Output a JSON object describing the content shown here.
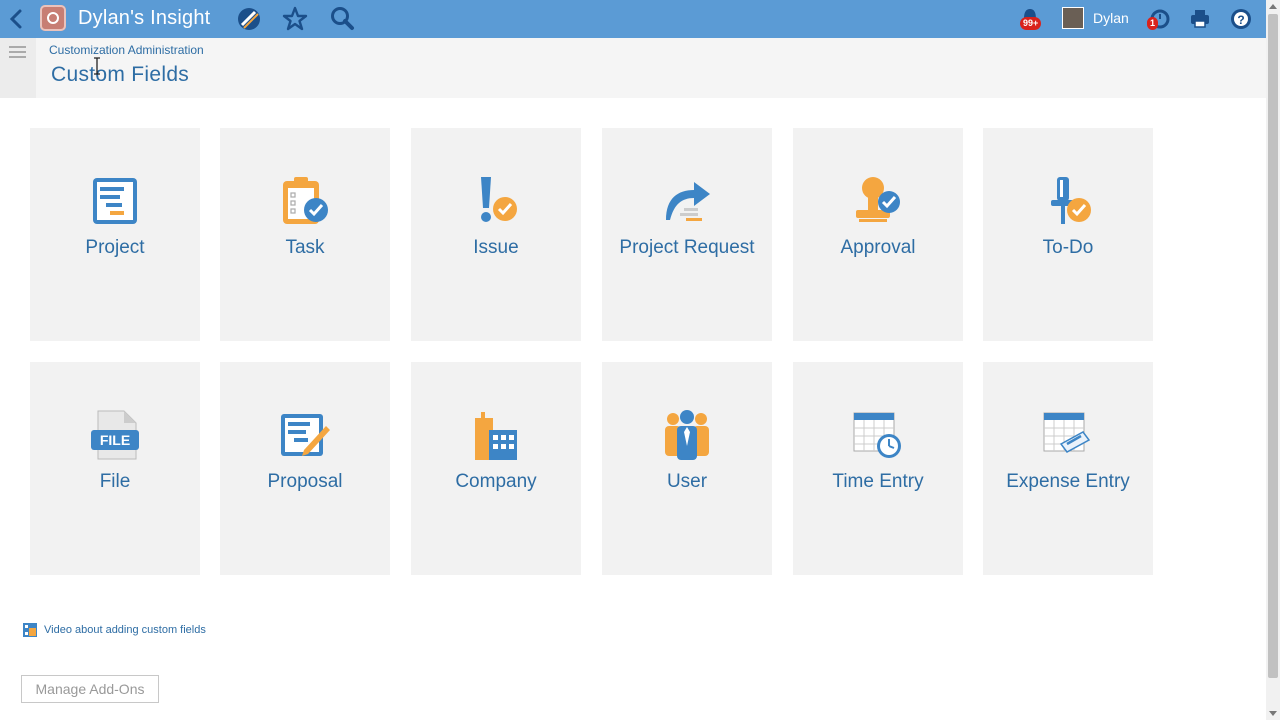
{
  "app": {
    "title": "Dylan's Insight"
  },
  "user": {
    "name": "Dylan",
    "notifications_count": "99+",
    "alerts_count": "1"
  },
  "breadcrumb": "Customization Administration",
  "page_title": "Custom Fields",
  "colors": {
    "header": "#5b9bd5",
    "accent": "#2e6da4",
    "icon_blue": "#3d85c6",
    "icon_orange": "#f4a640"
  },
  "tiles": [
    {
      "label": "Project",
      "icon": "project-icon"
    },
    {
      "label": "Task",
      "icon": "task-icon"
    },
    {
      "label": "Issue",
      "icon": "issue-icon"
    },
    {
      "label": "Project Request",
      "icon": "project-request-icon"
    },
    {
      "label": "Approval",
      "icon": "approval-icon"
    },
    {
      "label": "To-Do",
      "icon": "todo-icon"
    },
    {
      "label": "File",
      "icon": "file-icon"
    },
    {
      "label": "Proposal",
      "icon": "proposal-icon"
    },
    {
      "label": "Company",
      "icon": "company-icon"
    },
    {
      "label": "User",
      "icon": "user-icon"
    },
    {
      "label": "Time Entry",
      "icon": "time-entry-icon"
    },
    {
      "label": "Expense Entry",
      "icon": "expense-entry-icon"
    }
  ],
  "file_icon_text": "FILE",
  "video_link": "Video about adding custom fields",
  "manage_addons": "Manage Add-Ons"
}
